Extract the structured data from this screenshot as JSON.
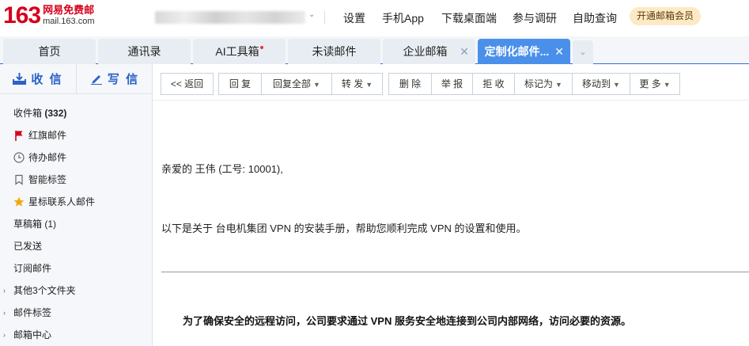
{
  "header": {
    "logo_number": "163",
    "logo_cn": "网易免费邮",
    "logo_domain": "mail.163.com",
    "links": [
      "设置",
      "手机App",
      "下载桌面端",
      "参与调研",
      "自助查询"
    ],
    "vip_button": "开通邮箱会员"
  },
  "tabs": [
    {
      "label": "首页"
    },
    {
      "label": "通讯录"
    },
    {
      "label": "AI工具箱"
    },
    {
      "label": "未读邮件"
    },
    {
      "label": "企业邮箱"
    },
    {
      "label": "定制化邮件..."
    }
  ],
  "sidebar": {
    "receive": "收 信",
    "compose": "写 信",
    "inbox_label": "收件箱",
    "inbox_count": "(332)",
    "flagged": "红旗邮件",
    "todo": "待办邮件",
    "smart_tags": "智能标签",
    "star_contacts": "星标联系人邮件",
    "drafts": "草稿箱 (1)",
    "sent": "已发送",
    "subscriptions": "订阅邮件",
    "other_folders": "其他3个文件夹",
    "mail_tags": "邮件标签",
    "mail_center": "邮箱中心"
  },
  "toolbar": {
    "back": "<< 返回",
    "reply": "回 复",
    "reply_all": "回复全部",
    "forward": "转 发",
    "delete": "删 除",
    "report": "举 报",
    "reject": "拒 收",
    "mark_as": "标记为",
    "move_to": "移动到",
    "more": "更 多"
  },
  "email": {
    "greeting": "亲爱的 王伟 (工号: 10001),",
    "intro": "以下是关于 台电机集团 VPN 的安装手册，帮助您顺利完成 VPN 的设置和使用。",
    "headline": "为了确保安全的远程访问，公司要求通过 VPN 服务安全地连接到公司内部网络，访问必要的资源。"
  },
  "colors": {
    "brand_red": "#d6001c",
    "accent_blue": "#4a90ea",
    "link_blue": "#2a62c9",
    "vip_bg": "#fde9c3"
  }
}
